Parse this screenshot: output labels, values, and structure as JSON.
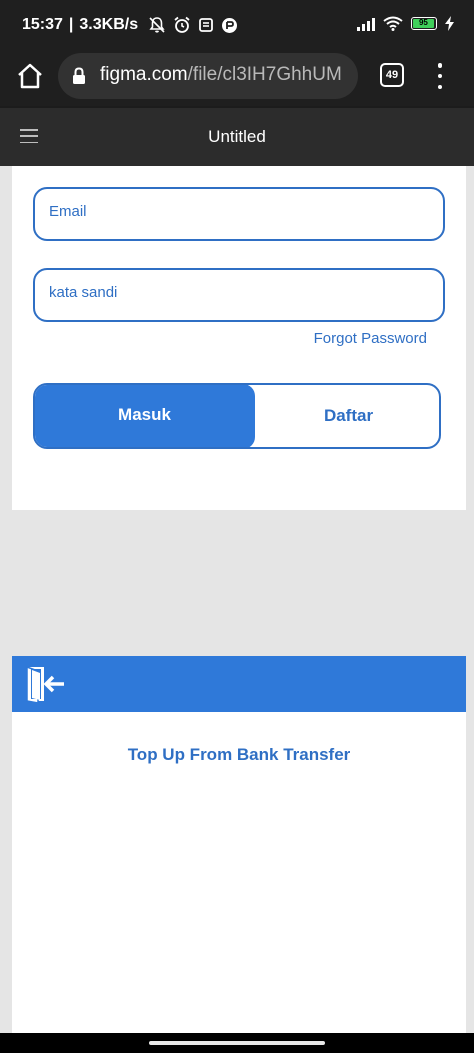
{
  "status_bar": {
    "time": "15:37",
    "net_speed": "3.3KB/s",
    "battery": "95",
    "icons": [
      "notifications-off-icon",
      "alarm-icon",
      "message-icon",
      "app-notification-icon",
      "signal-icon",
      "wifi-icon",
      "battery-icon",
      "charging-icon"
    ]
  },
  "browser": {
    "url_domain": "figma.com",
    "url_path": "/file/cl3IH7GhhUM",
    "tab_count": "49",
    "icons": [
      "home-icon",
      "lock-icon",
      "menu-dots-icon"
    ]
  },
  "figma": {
    "title": "Untitled",
    "icons": [
      "hamburger-menu-icon"
    ]
  },
  "login": {
    "email_placeholder": "Email",
    "password_placeholder": "kata sandi",
    "forgot_password": "Forgot Password",
    "masuk_label": "Masuk",
    "daftar_label": "Daftar"
  },
  "topup": {
    "text": "Top Up From Bank Transfer",
    "icons": [
      "exit-door-icon"
    ]
  },
  "colors": {
    "primary_blue": "#2f79d9",
    "border_blue": "#2f6fc4",
    "canvas_gray": "#e5e5e5",
    "figma_bar": "#2c2c2c"
  }
}
